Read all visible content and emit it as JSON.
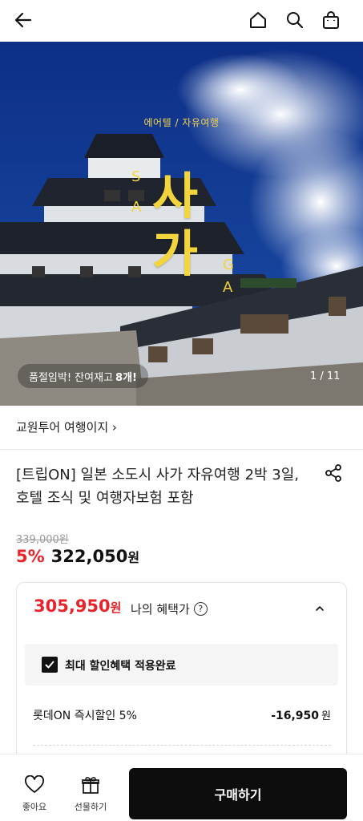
{
  "header": {
    "icons": [
      "back-arrow-icon",
      "home-icon",
      "search-icon",
      "shopping-bag-icon"
    ]
  },
  "hero": {
    "kicker": "에어텔 / 자유여행",
    "big_line1": "사",
    "big_line2": "가",
    "latin": [
      "S",
      "A",
      "G",
      "A"
    ],
    "stock_prefix": "품절임박! 잔여재고",
    "stock_count": "8개!",
    "pager": "1 / 11"
  },
  "vendor": {
    "label": "교원투어 여행이지 ›"
  },
  "product": {
    "title": "[트립ON] 일본 소도시 사가 자유여행 2박 3일, 호텔 조식 및 여행자보험 포함",
    "original_price": "339,000원",
    "discount": "5%",
    "price": "322,050",
    "price_unit": "원"
  },
  "benefit": {
    "price": "305,950",
    "price_unit": "원",
    "label": "나의 혜택가",
    "help": "?",
    "checkbox_label": "최대 할인혜택 적용완료",
    "checked": true,
    "items": [
      {
        "name": "롯데ON 즉시할인 5%",
        "value": "-16,950",
        "unit": "원"
      }
    ]
  },
  "bottom": {
    "like_label": "좋아요",
    "gift_label": "선물하기",
    "buy_label": "구매하기"
  },
  "colors": {
    "accent_red": "#e8232a",
    "buy_bg": "#0d0d0d",
    "hero_text": "#f2d53c"
  }
}
